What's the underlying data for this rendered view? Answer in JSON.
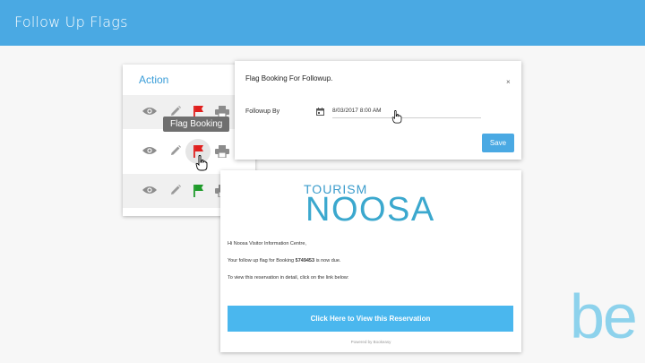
{
  "header": {
    "title": "Follow Up Flags"
  },
  "action_panel": {
    "header": "Action",
    "tooltip": "Flag Booking",
    "rows": [
      {
        "flag_color": "#e0201e"
      },
      {
        "flag_color": "#e0201e"
      },
      {
        "flag_color": "#1f9b2b"
      }
    ]
  },
  "dialog": {
    "title": "Flag Booking For Followup.",
    "close": "×",
    "followup_label": "Followup By",
    "date_value": "8/03/2017 8:00 AM",
    "save_label": "Save"
  },
  "email": {
    "logo_small": "TOURISM",
    "logo_large": "NOOSA",
    "greeting": "Hi Noosa Visitor Information Centre,",
    "line_prefix": "Your follow up flag for Booking",
    "booking_number": "5749453",
    "line_suffix": "is now due.",
    "details_line": "To view this reservation in detail, click on the link below:",
    "cta_label": "Click Here to View this Reservation",
    "powered_by": "Powered by Bookeasy"
  },
  "brand": {
    "logo": "be"
  },
  "colors": {
    "accent": "#4aa9e3",
    "flag_red": "#e0201e",
    "flag_green": "#1f9b2b"
  }
}
